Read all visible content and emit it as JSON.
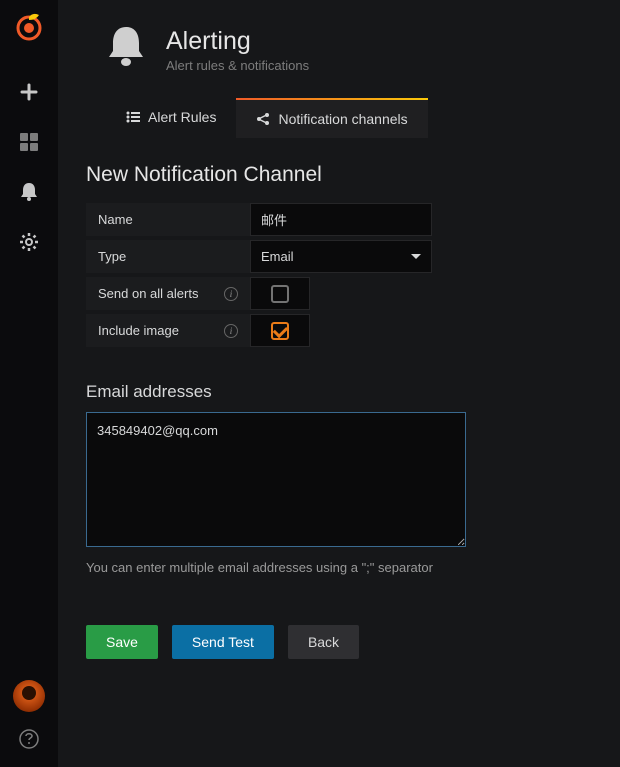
{
  "page": {
    "title": "Alerting",
    "subtitle": "Alert rules & notifications"
  },
  "tabs": {
    "alertRules": "Alert Rules",
    "notificationChannels": "Notification channels"
  },
  "form": {
    "title": "New Notification Channel",
    "nameLabel": "Name",
    "nameValue": "邮件",
    "typeLabel": "Type",
    "typeValue": "Email",
    "sendAllLabel": "Send on all alerts",
    "sendAllChecked": false,
    "includeImageLabel": "Include image",
    "includeImageChecked": true,
    "emailLabel": "Email addresses",
    "emailValue": "345849402@qq.com",
    "emailHelp": "You can enter multiple email addresses using a \";\" separator"
  },
  "buttons": {
    "save": "Save",
    "sendTest": "Send Test",
    "back": "Back"
  }
}
